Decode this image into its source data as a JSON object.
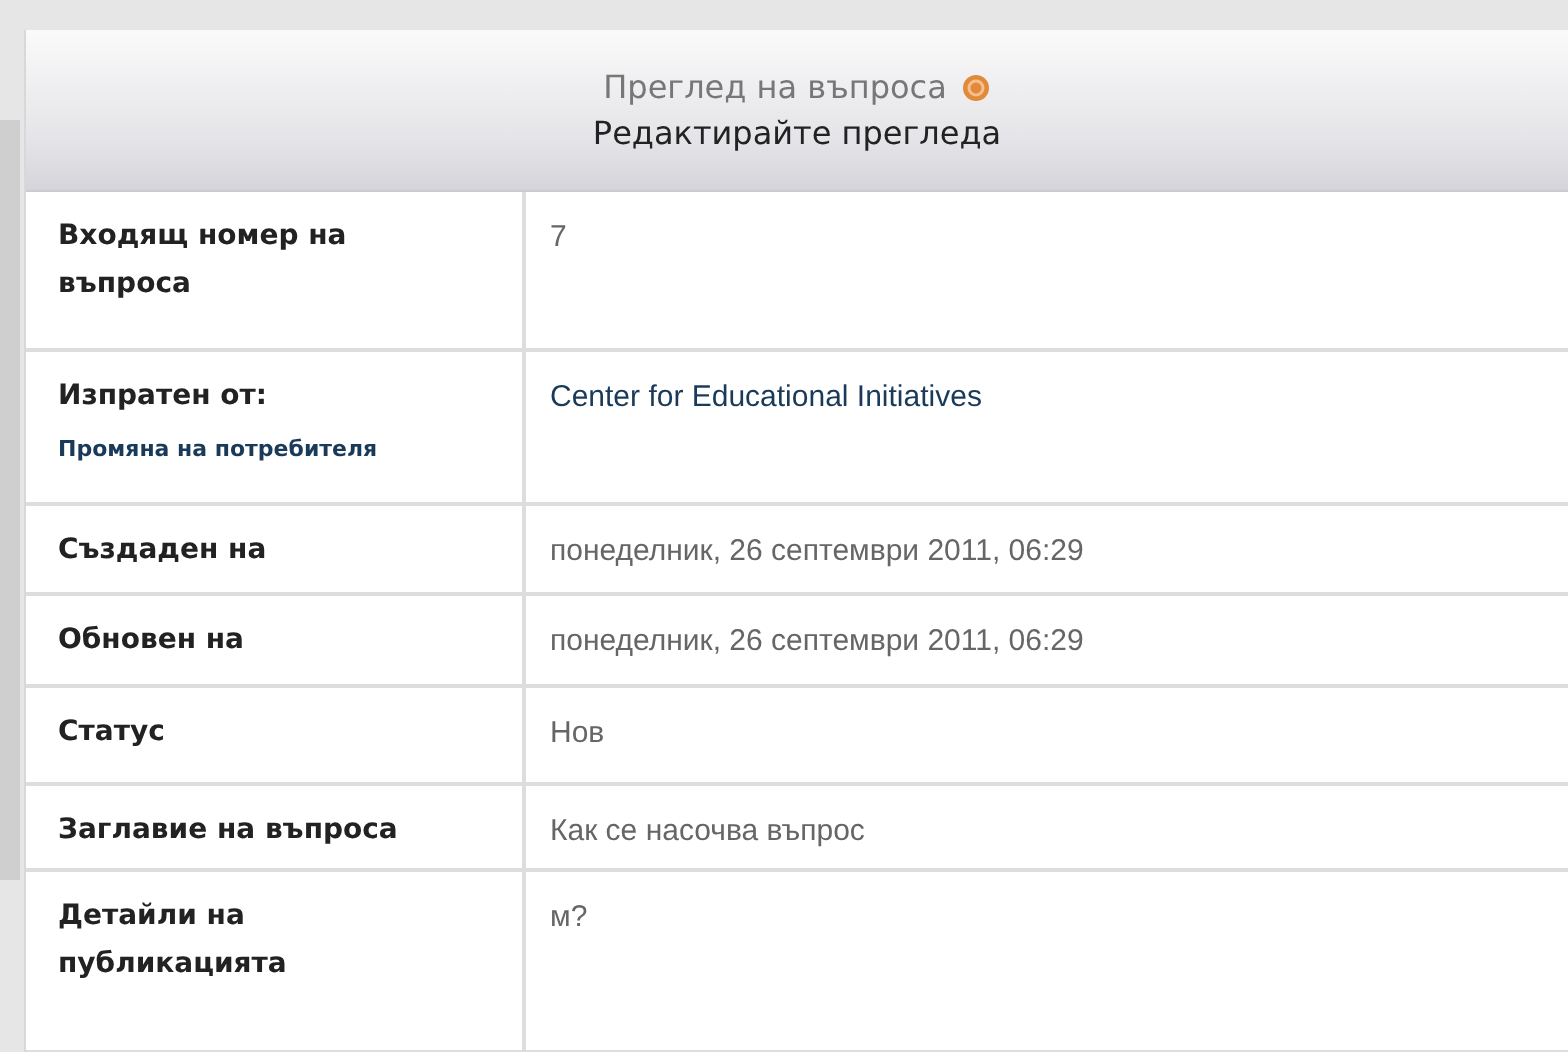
{
  "header": {
    "title": "Преглед на въпроса",
    "subtitle": "Редактирайте прегледа"
  },
  "rows": [
    {
      "label": "Входящ номер на въпроса",
      "value": "7"
    },
    {
      "label": "Изпратен от:",
      "link": "Промяна на потребителя",
      "value": "Center for Educational Initiatives"
    },
    {
      "label": "Създаден на",
      "value": "понеделник, 26 септември 2011, 06:29"
    },
    {
      "label": "Обновен на",
      "value": "понеделник, 26 септември 2011, 06:29"
    },
    {
      "label": "Статус",
      "value": "Нов"
    },
    {
      "label": "Заглавие на въпроса",
      "value": "Как се насочва въпрос"
    },
    {
      "label": "Детайли на публикацията",
      "value": "м?"
    }
  ]
}
